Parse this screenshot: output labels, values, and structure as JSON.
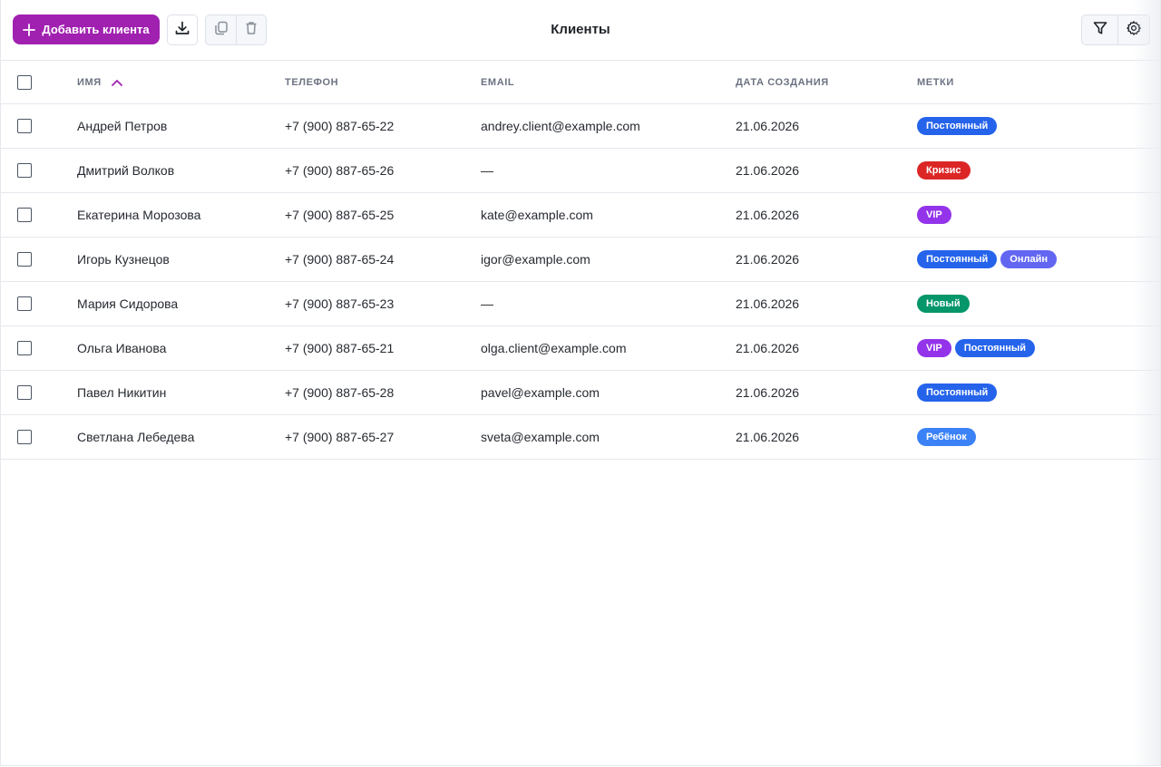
{
  "toolbar": {
    "add_label": "Добавить клиента",
    "title": "Клиенты",
    "icons": {
      "add": "plus-icon",
      "download": "download-icon",
      "copy": "copy-icon",
      "delete": "trash-icon",
      "filter": "filter-icon",
      "settings": "gear-icon"
    }
  },
  "table": {
    "columns": {
      "name": "Имя",
      "phone": "Телефон",
      "email": "Email",
      "date": "Дата создания",
      "tags": "Метки"
    },
    "sort": {
      "column": "name",
      "direction": "ascending"
    },
    "rows": [
      {
        "name": "Андрей Петров",
        "phone": "+7 (900) 887-65-22",
        "email": "andrey.client@example.com",
        "date": "21.06.2026",
        "tags": [
          "Постоянный"
        ]
      },
      {
        "name": "Дмитрий Волков",
        "phone": "+7 (900) 887-65-26",
        "email": "—",
        "date": "21.06.2026",
        "tags": [
          "Кризис"
        ]
      },
      {
        "name": "Екатерина Морозова",
        "phone": "+7 (900) 887-65-25",
        "email": "kate@example.com",
        "date": "21.06.2026",
        "tags": [
          "VIP"
        ]
      },
      {
        "name": "Игорь Кузнецов",
        "phone": "+7 (900) 887-65-24",
        "email": "igor@example.com",
        "date": "21.06.2026",
        "tags": [
          "Постоянный",
          "Онлайн"
        ]
      },
      {
        "name": "Мария Сидорова",
        "phone": "+7 (900) 887-65-23",
        "email": "—",
        "date": "21.06.2026",
        "tags": [
          "Новый"
        ]
      },
      {
        "name": "Ольга Иванова",
        "phone": "+7 (900) 887-65-21",
        "email": "olga.client@example.com",
        "date": "21.06.2026",
        "tags": [
          "VIP",
          "Постоянный"
        ]
      },
      {
        "name": "Павел Никитин",
        "phone": "+7 (900) 887-65-28",
        "email": "pavel@example.com",
        "date": "21.06.2026",
        "tags": [
          "Постоянный"
        ]
      },
      {
        "name": "Светлана Лебедева",
        "phone": "+7 (900) 887-65-27",
        "email": "sveta@example.com",
        "date": "21.06.2026",
        "tags": [
          "Ребёнок"
        ]
      }
    ]
  },
  "tag_colors": {
    "Постоянный": "#2563eb",
    "Кризис": "#dc2626",
    "VIP": "#9333ea",
    "Онлайн": "#6366f1",
    "Новый": "#059669",
    "Ребёнок": "#3b82f6"
  },
  "colors": {
    "accent": "#a020b0",
    "border": "#e6e8ee",
    "header_text": "#6b7280"
  }
}
